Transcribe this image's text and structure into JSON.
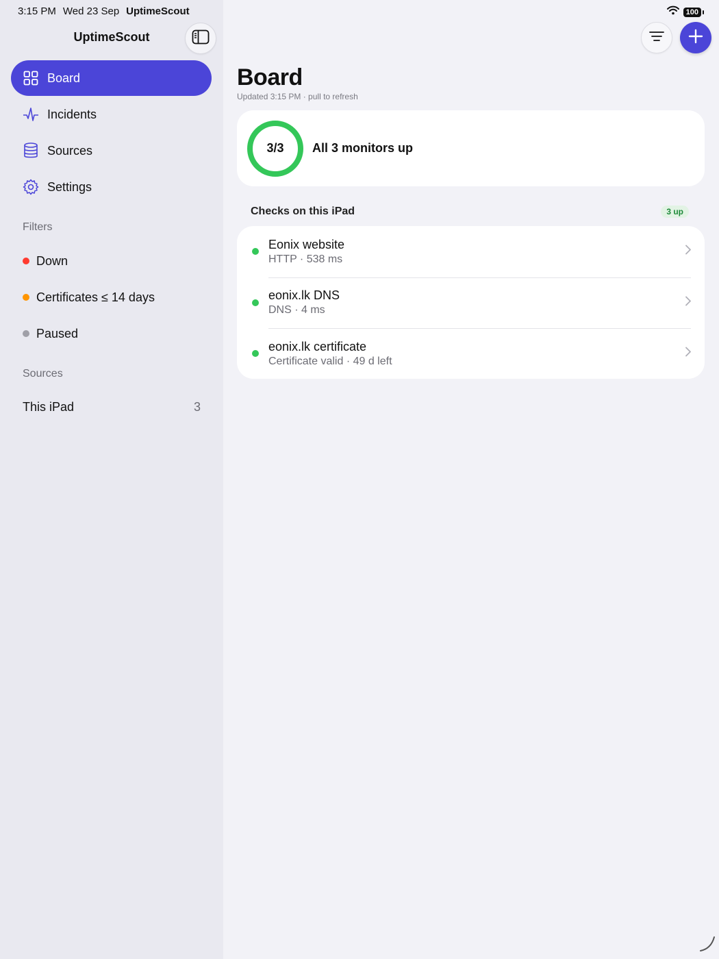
{
  "status_bar": {
    "time": "3:15 PM",
    "date": "Wed 23 Sep",
    "app": "UptimeScout",
    "battery": "100"
  },
  "sidebar": {
    "title": "UptimeScout",
    "nav": [
      {
        "label": "Board",
        "icon": "grid-icon",
        "active": true
      },
      {
        "label": "Incidents",
        "icon": "pulse-icon",
        "active": false
      },
      {
        "label": "Sources",
        "icon": "database-icon",
        "active": false
      },
      {
        "label": "Settings",
        "icon": "gear-icon",
        "active": false
      }
    ],
    "filters_label": "Filters",
    "filters": [
      {
        "label": "Down",
        "color": "#ff3b30"
      },
      {
        "label": "Certificates ≤ 14 days",
        "color": "#ff9500"
      },
      {
        "label": "Paused",
        "color": "#a0a0a8"
      }
    ],
    "sources_label": "Sources",
    "sources": [
      {
        "label": "This iPad",
        "count": "3"
      }
    ]
  },
  "main": {
    "title": "Board",
    "subtitle": "Updated 3:15 PM · pull to refresh",
    "summary": {
      "ring_label": "3/3",
      "text": "All 3 monitors up",
      "up_fraction": 1.0
    },
    "list": {
      "header": "Checks on this iPad",
      "badge": "3 up",
      "items": [
        {
          "name": "Eonix website",
          "detail": "HTTP · 538 ms",
          "status_color": "#34c759"
        },
        {
          "name": "eonix.lk DNS",
          "detail": "DNS · 4 ms",
          "status_color": "#34c759"
        },
        {
          "name": "eonix.lk certificate",
          "detail": "Certificate valid · 49 d left",
          "status_color": "#34c759"
        }
      ]
    }
  },
  "colors": {
    "accent": "#4b45d8",
    "up": "#34c759",
    "down": "#ff3b30",
    "warning": "#ff9500"
  }
}
